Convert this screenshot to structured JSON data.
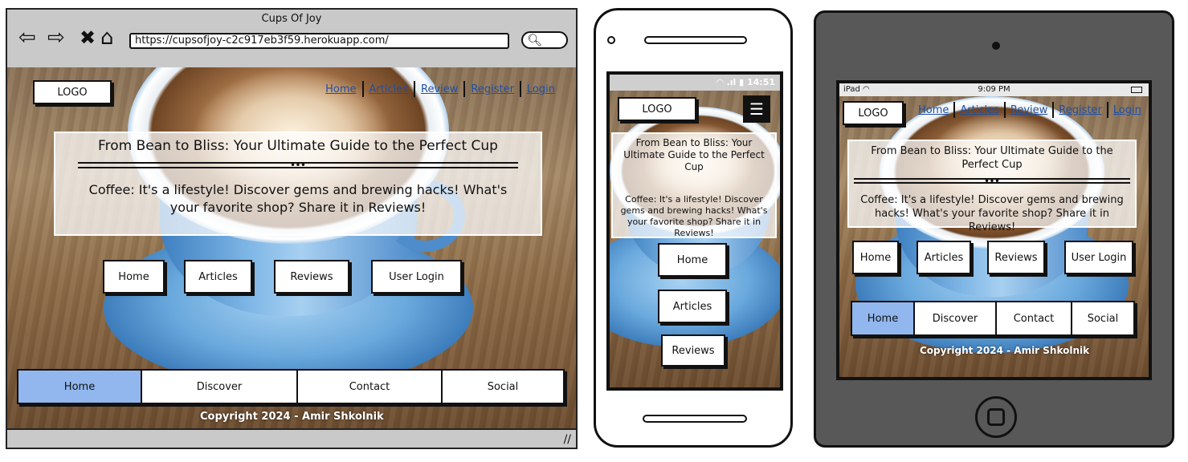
{
  "browser": {
    "window_title": "Cups Of Joy",
    "url": "https://cupsofjoy-c2c917eb3f59.herokuapp.com/",
    "toolbar_icons": [
      "back-arrow-icon",
      "forward-arrow-icon",
      "close-x-icon",
      "home-icon",
      "search-icon"
    ]
  },
  "site": {
    "logo": "LOGO",
    "nav": [
      "Home",
      "Articles",
      "Review",
      "Register",
      "Login"
    ],
    "hero_title": "From Bean to Bliss: Your Ultimate Guide to the Perfect Cup",
    "hero_divider_dots": "•••",
    "hero_text": "Coffee: It's a lifestyle! Discover gems and brewing hacks! What's your favorite shop? Share it in Reviews!",
    "buttons": [
      "Home",
      "Articles",
      "Reviews",
      "User Login"
    ],
    "footer_nav": [
      "Home",
      "Discover",
      "Contact",
      "Social"
    ],
    "footer_active": "Home",
    "copyright": "Copyright 2024 - Amir Shkolnik"
  },
  "phone": {
    "status_time": "14:51",
    "buttons": [
      "Home",
      "Articles",
      "Reviews"
    ],
    "menu_icon": "hamburger-icon"
  },
  "tablet": {
    "status_device": "iPad",
    "status_time": "9:09 PM",
    "icons": [
      "wifi-icon",
      "battery-icon"
    ]
  },
  "colors": {
    "active_tab": "#91b7ee",
    "link": "#1f4fa0",
    "frame_gray": "#c9c9c9",
    "tablet_body": "#585858"
  }
}
